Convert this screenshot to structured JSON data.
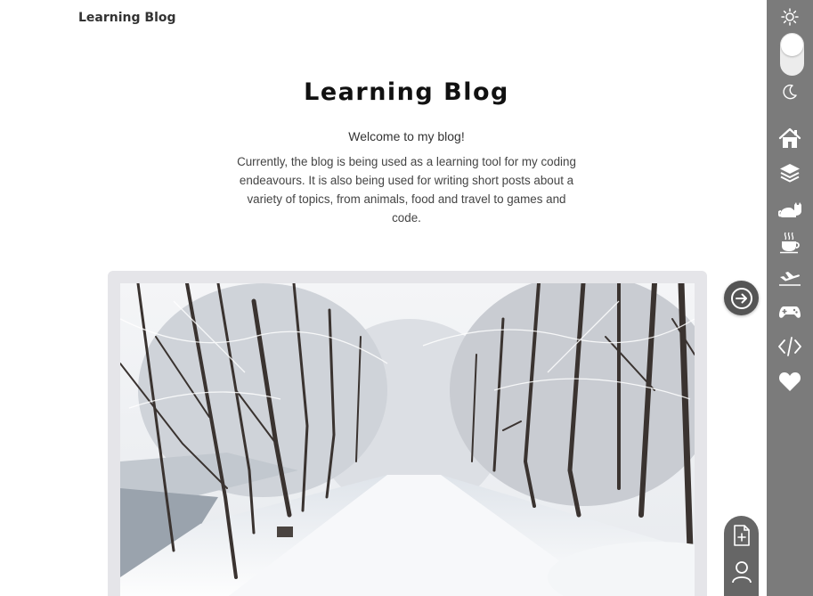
{
  "header": {
    "brand": "Learning Blog"
  },
  "hero": {
    "title": "Learning Blog",
    "welcome": "Welcome to my blog!",
    "description": "Currently, the blog is being used as a learning tool for my coding endeavours. It is also being used for writing short posts about a variety of topics, from animals, food and travel to games and code."
  },
  "featured": {
    "image": "snowy-forest-road-photo"
  },
  "sidebar": {
    "theme_toggle": {
      "light_icon": "sun-icon",
      "dark_icon": "moon-icon",
      "state": "light"
    },
    "nav": [
      {
        "icon": "home-icon"
      },
      {
        "icon": "layers-icon"
      },
      {
        "icon": "cat-icon"
      },
      {
        "icon": "coffee-icon"
      },
      {
        "icon": "airplane-icon"
      },
      {
        "icon": "gamepad-icon"
      },
      {
        "icon": "code-icon"
      },
      {
        "icon": "heart-icon"
      }
    ]
  },
  "actions": {
    "next": "arrow-right-circle-icon",
    "new_post": "new-document-icon",
    "account": "user-icon"
  },
  "colors": {
    "sidebar": "#7b7b7b",
    "card": "#e5e5e9",
    "fab": "#666666",
    "next_button": "#555555"
  }
}
